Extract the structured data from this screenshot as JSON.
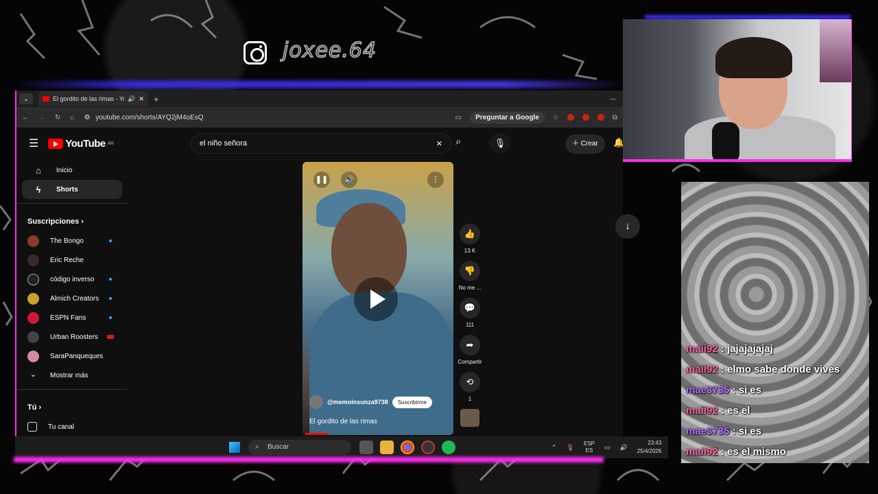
{
  "overlay": {
    "handle": "joxee.64"
  },
  "browser": {
    "tab_title": "El gordito de las rimas - YouTube",
    "url": "youtube.com/shorts/AYQ2jM4oEsQ",
    "ask_google": "Preguntar a Google"
  },
  "youtube": {
    "logo": "YouTube",
    "region": "AR",
    "search_query": "el niño señora",
    "create_label": "Crear",
    "nav": [
      {
        "label": "Inicio",
        "icon": "home-icon"
      },
      {
        "label": "Shorts",
        "icon": "shorts-icon"
      }
    ],
    "subscriptions_title": "Suscripciones",
    "subscriptions": [
      {
        "name": "The Bongo",
        "color": "#8a3a2a",
        "indicator": "new"
      },
      {
        "name": "Eric Reche",
        "color": "#3a2a2a",
        "indicator": ""
      },
      {
        "name": "código inverso",
        "color": "#222222",
        "indicator": "new"
      },
      {
        "name": "Almich Creators",
        "color": "#c8a22a",
        "indicator": "new"
      },
      {
        "name": "ESPN Fans",
        "color": "#d2173a",
        "indicator": "new"
      },
      {
        "name": "Urban Roosters",
        "color": "#444444",
        "indicator": "live"
      },
      {
        "name": "SaraPanqueques",
        "color": "#d28aa0",
        "indicator": ""
      }
    ],
    "show_more": "Mostrar más",
    "you_title": "Tú",
    "your_channel": "Tu canal",
    "short": {
      "channel": "@memoinsunza9738",
      "subscribe": "Suscribirme",
      "title": "El gordito de las rimas",
      "progress_fraction": 0.15
    },
    "actions": {
      "likes": "13 K",
      "dislike": "No me ...",
      "comments": "111",
      "share": "Compartir",
      "remix": "1"
    }
  },
  "taskbar": {
    "search": "Buscar",
    "lang_top": "ESP",
    "lang_bottom": "ES",
    "time": "23:43",
    "date": "25/4/2026"
  },
  "chat": [
    {
      "user": "maii92",
      "text": "jajajajajaj",
      "color": "#ff5fa2"
    },
    {
      "user": "maii92",
      "text": "elmo sabe donde vives",
      "color": "#ff5fa2"
    },
    {
      "user": "mae3735",
      "text": "si es",
      "color": "#b36bff"
    },
    {
      "user": "maii92",
      "text": "es el",
      "color": "#ff5fa2"
    },
    {
      "user": "mae3735",
      "text": "si es",
      "color": "#b36bff"
    },
    {
      "user": "maii92",
      "text": "es el mismo",
      "color": "#ff5fa2"
    }
  ]
}
